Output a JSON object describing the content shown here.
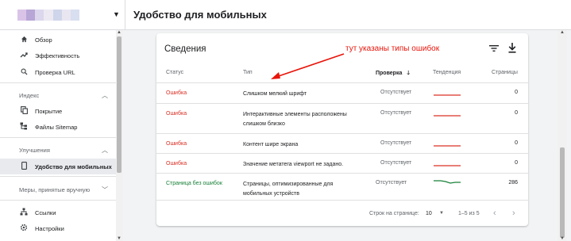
{
  "header": {
    "page_title": "Удобство для мобильных",
    "property_placeholder_colors": [
      "#d9c4e8",
      "#b7a6d6",
      "#dcd7ec",
      "#ece9f3",
      "#cfd5ea",
      "#e9e6f2",
      "#d7dff0"
    ]
  },
  "sidebar": {
    "top_items": [
      {
        "label": "Обзор",
        "icon": "home-icon"
      },
      {
        "label": "Эффективность",
        "icon": "trending-up-icon"
      },
      {
        "label": "Проверка URL",
        "icon": "search-icon"
      }
    ],
    "sections": [
      {
        "title": "Индекс",
        "items": [
          {
            "label": "Покрытие",
            "icon": "coverage-icon"
          },
          {
            "label": "Файлы Sitemap",
            "icon": "sitemap-icon"
          }
        ]
      },
      {
        "title": "Улучшения",
        "items": [
          {
            "label": "Удобство для мобильных",
            "icon": "phone-icon",
            "active": true
          }
        ]
      },
      {
        "title": "Меры, принятые вручную",
        "items": []
      }
    ],
    "bottom_items": [
      {
        "label": "Ссылки",
        "icon": "links-icon"
      },
      {
        "label": "Настройки",
        "icon": "settings-icon"
      }
    ]
  },
  "card": {
    "title": "Сведения",
    "annotation": "тут указаны типы ошибок",
    "columns": {
      "status": "Статус",
      "type": "Тип",
      "check": "Проверка",
      "trend": "Тенденция",
      "pages": "Страницы"
    },
    "rows": [
      {
        "status": "Ошибка",
        "status_kind": "error",
        "type": "Слишком мелкий шрифт",
        "check": "Отсутствует",
        "trend_color": "#d93025",
        "trend": "flat",
        "pages": "0"
      },
      {
        "status": "Ошибка",
        "status_kind": "error",
        "type": "Интерактивные элементы расположены слишком близко",
        "check": "Отсутствует",
        "trend_color": "#d93025",
        "trend": "flat",
        "pages": "0"
      },
      {
        "status": "Ошибка",
        "status_kind": "error",
        "type": "Контент шире экрана",
        "check": "Отсутствует",
        "trend_color": "#d93025",
        "trend": "flat",
        "pages": "0"
      },
      {
        "status": "Ошибка",
        "status_kind": "error",
        "type": "Значение метатега viewport не задано.",
        "check": "Отсутствует",
        "trend_color": "#d93025",
        "trend": "flat",
        "pages": "0"
      },
      {
        "status": "Страница без ошибок",
        "status_kind": "ok",
        "type": "Страницы, оптимизированные для мобильных устройств",
        "check": "Отсутствует",
        "trend_color": "#188038",
        "trend": "dip",
        "pages": "286"
      }
    ],
    "footer": {
      "rows_per_page_label": "Строк на странице:",
      "rows_per_page_value": "10",
      "range": "1–5 из 5"
    }
  }
}
